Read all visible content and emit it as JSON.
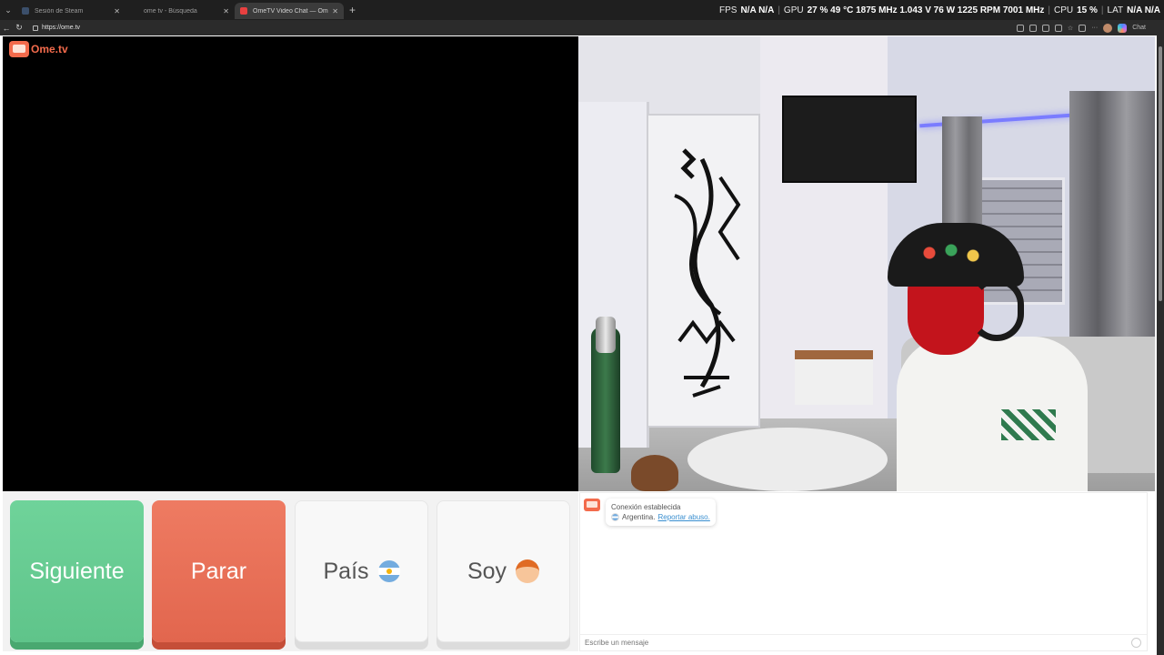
{
  "browser": {
    "tabs": [
      {
        "title": "Sesión de Steam",
        "favicon_color": "#3b4f6b"
      },
      {
        "title": "ome tv - Búsqueda",
        "favicon_color": "#333333"
      },
      {
        "title": "OmeTV Video Chat — Omegl",
        "favicon_color": "#e84040"
      }
    ],
    "address": "https://ome.tv",
    "chat_button": "Chat"
  },
  "overlay": {
    "fps_label": "FPS",
    "fps_values": "N/A  N/A",
    "sep": "|",
    "gpu_label": "GPU",
    "gpu_stats": "27 %  49 °C  1875 MHz  1.043 V  76 W  1225 RPM  7001 MHz",
    "cpu_label": "CPU",
    "cpu_value": "15 %",
    "lat_label": "LAT",
    "lat_values": "N/A  N/A"
  },
  "site": {
    "logo_text": "Ome.tv"
  },
  "controls": {
    "next_label": "Siguiente",
    "stop_label": "Parar",
    "country_label": "País",
    "gender_label": "Soy"
  },
  "chat": {
    "status": "Conexión establecida",
    "country": "Argentina.",
    "report_link": "Reportar abuso.",
    "input_placeholder": "Escribe un mensaje"
  }
}
